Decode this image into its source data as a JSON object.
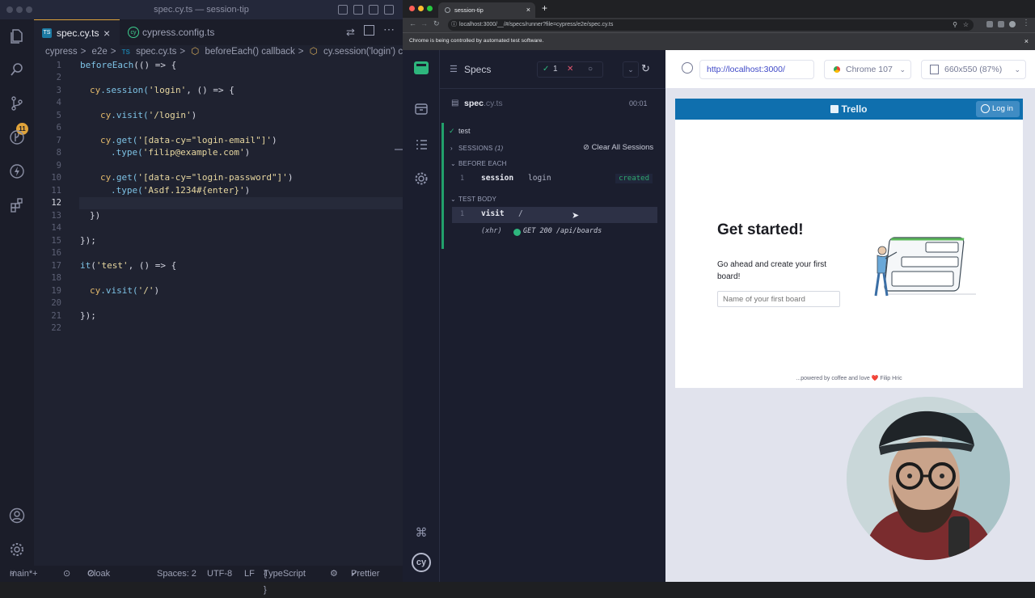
{
  "vscode": {
    "window_title": "spec.cy.ts — session-tip",
    "tabs": [
      {
        "label": "spec.cy.ts",
        "close": "×"
      },
      {
        "label": "cypress.config.ts"
      }
    ],
    "breadcrumbs": [
      "cypress",
      ">",
      "e2e",
      ">",
      "spec.cy.ts",
      ">",
      "beforeEach() callback",
      ">",
      "cy.session('login') ca"
    ],
    "source_control_badge": "11",
    "lines": [
      "1",
      "2",
      "3",
      "4",
      "5",
      "6",
      "7",
      "8",
      "9",
      "10",
      "11",
      "12",
      "13",
      "14",
      "15",
      "16",
      "17",
      "18",
      "19",
      "20",
      "21",
      "22"
    ],
    "code": {
      "l1a": "beforeEach",
      "l1b": "(() => {",
      "l3a": "cy",
      "l3b": ".session(",
      "l3c": "'login'",
      "l3d": ", () => {",
      "l5a": "cy",
      "l5b": ".visit(",
      "l5c": "'/login'",
      "l5d": ")",
      "l7a": "cy",
      "l7b": ".get(",
      "l7c": "'[data-cy=\"login-email\"]'",
      "l7d": ")",
      "l8a": ".type(",
      "l8b": "'filip@example.com'",
      "l8c": ")",
      "l10a": "cy",
      "l10b": ".get(",
      "l10c": "'[data-cy=\"login-password\"]'",
      "l10d": ")",
      "l11a": ".type(",
      "l11b": "'Asdf.1234#{enter}'",
      "l11c": ")",
      "l13": "})",
      "l15": "});",
      "l17a": "it",
      "l17b": "(",
      "l17c": "'test'",
      "l17d": ", () => {",
      "l19a": "cy",
      "l19b": ".visit(",
      "l19c": "'/'",
      "l19d": ")",
      "l21": "});"
    },
    "status": {
      "branch": "main*+",
      "cloak": "Cloak",
      "spaces": "Spaces: 2",
      "encoding": "UTF-8",
      "eol": "LF",
      "language": "TypeScript",
      "formatter": "Prettier"
    }
  },
  "browser": {
    "tab_title": "session-tip",
    "url": "localhost:3000/__/#/specs/runner?file=cypress/e2e/spec.cy.ts",
    "automation_notice": "Chrome is being controlled by automated test software."
  },
  "cypress": {
    "specs_label": "Specs",
    "passed": "1",
    "failed": "✕",
    "pending": "○",
    "spec_name": "spec",
    "spec_ext": ".cy.ts",
    "duration": "00:01",
    "test_title": "test",
    "sessions_label": "SESSIONS",
    "sessions_count": "(1)",
    "clear_sessions": "Clear All Sessions",
    "before_each": "BEFORE EACH",
    "cmd1": {
      "num": "1",
      "name": "session",
      "msg": "login",
      "status": "created"
    },
    "test_body": "TEST BODY",
    "cmd2": {
      "num": "1",
      "name": "visit",
      "msg": "/"
    },
    "xhr": {
      "type": "(xhr)",
      "text": "GET 200 /api/boards"
    },
    "aut_url": "http://localhost:3000/",
    "browser_name": "Chrome 107",
    "viewport": "660x550 (87%)"
  },
  "trello": {
    "brand": "Trello",
    "login": "Log in",
    "heading": "Get started!",
    "subtext": "Go ahead and create your first board!",
    "placeholder": "Name of your first board",
    "footer_a": "...powered by coffee and love",
    "footer_heart": "❤️",
    "footer_b": "Filip Hric"
  },
  "colors": {
    "accent_green": "#22a06b",
    "trello_blue": "#0f6fae",
    "vscode_bg": "#1f2230",
    "cypress_bg": "#1b1e2e"
  }
}
